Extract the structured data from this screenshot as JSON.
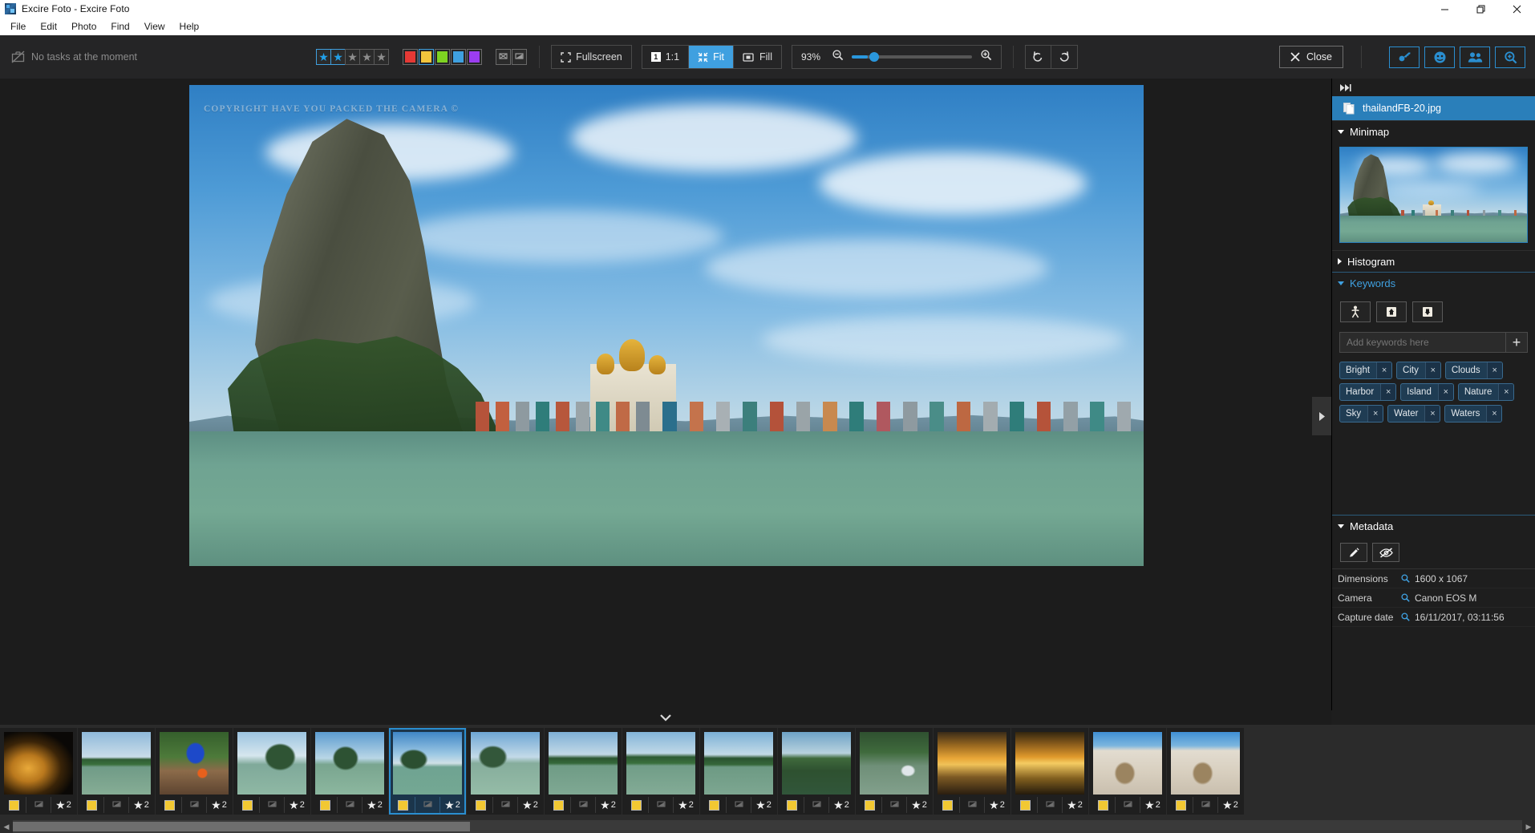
{
  "window": {
    "title": "Excire Foto - Excire Foto",
    "app_icon": "app-logo-icon",
    "minimize": "minimize-icon",
    "restore": "restore-icon",
    "close": "close-icon"
  },
  "menubar": {
    "items": [
      "File",
      "Edit",
      "Photo",
      "Find",
      "View",
      "Help"
    ]
  },
  "toolbar": {
    "task_status": "No tasks at the moment",
    "task_icon": "briefcase-off-icon",
    "ratings": [
      {
        "name": "star-1",
        "filled": true
      },
      {
        "name": "star-2",
        "filled": true
      },
      {
        "name": "star-3",
        "filled": false
      },
      {
        "name": "star-4",
        "filled": false
      },
      {
        "name": "star-5",
        "filled": false
      }
    ],
    "colors": [
      {
        "name": "red",
        "hex": "#e53935",
        "selected": false
      },
      {
        "name": "yellow",
        "hex": "#f2c43c",
        "selected": true
      },
      {
        "name": "green",
        "hex": "#7ed321",
        "selected": false
      },
      {
        "name": "blue",
        "hex": "#3fa0e0",
        "selected": false
      },
      {
        "name": "purple",
        "hex": "#9b3df0",
        "selected": false
      }
    ],
    "flags": [
      {
        "name": "flag-rejected-icon"
      },
      {
        "name": "flag-picked-icon"
      }
    ],
    "fullscreen_label": "Fullscreen",
    "view_modes": [
      {
        "label": "1:1",
        "active": false,
        "icon": "one-to-one-icon"
      },
      {
        "label": "Fit",
        "active": true,
        "icon": "fit-icon"
      },
      {
        "label": "Fill",
        "active": false,
        "icon": "fill-icon"
      }
    ],
    "zoom_percent": "93%",
    "zoom_out_icon": "zoom-out-icon",
    "zoom_in_icon": "zoom-in-icon",
    "zoom_slider_value": 13,
    "rotate_left_icon": "rotate-left-icon",
    "rotate_right_icon": "rotate-right-icon",
    "close_label": "Close",
    "right_icons": [
      {
        "name": "key-icon"
      },
      {
        "name": "face-icon"
      },
      {
        "name": "people-icon"
      },
      {
        "name": "search-photo-icon"
      }
    ]
  },
  "viewer": {
    "watermark": "COPYRIGHT HAVE YOU PACKED THE CAMERA ©",
    "collapse_handle_icon": "chevron-right-icon",
    "strip_toggle_icon": "chevron-down-icon"
  },
  "right_panel": {
    "fastforward_icon": "fast-forward-icon",
    "file_name": "thailandFB-20.jpg",
    "file_icon": "document-copy-icon",
    "sections": {
      "minimap": {
        "label": "Minimap",
        "expanded": true
      },
      "histogram": {
        "label": "Histogram",
        "expanded": false
      },
      "keywords": {
        "label": "Keywords",
        "expanded": true
      },
      "metadata": {
        "label": "Metadata",
        "expanded": true
      }
    },
    "keyword_tools": [
      {
        "name": "person-keyword-icon"
      },
      {
        "name": "import-keywords-icon"
      },
      {
        "name": "export-keywords-icon"
      }
    ],
    "keyword_input_placeholder": "Add keywords here",
    "keyword_add_label": "+",
    "keywords": [
      "Bright",
      "City",
      "Clouds",
      "Harbor",
      "Island",
      "Nature",
      "Sky",
      "Water",
      "Waters"
    ],
    "keyword_remove_label": "×",
    "metadata_tools": [
      {
        "name": "edit-metadata-icon"
      },
      {
        "name": "hide-metadata-icon"
      }
    ],
    "metadata": [
      {
        "key": "Dimensions",
        "value": "1600 x 1067"
      },
      {
        "key": "Camera",
        "value": "Canon EOS M"
      },
      {
        "key": "Capture date",
        "value": "16/11/2017, 03:11:56"
      }
    ]
  },
  "filmstrip": {
    "rating_value": "2",
    "color_label_hex": "#f2c832",
    "scroll_left_icon": "chevron-left-icon",
    "scroll_right_icon": "chevron-right-icon",
    "thumbs": [
      {
        "name": "thumb-buddha",
        "selected": false,
        "rating": "2",
        "color": "#f2c832"
      },
      {
        "name": "thumb-mangrove-1",
        "selected": false,
        "rating": "2",
        "color": "#f2c832"
      },
      {
        "name": "thumb-market-boat",
        "selected": false,
        "rating": "2",
        "color": "#f2c832"
      },
      {
        "name": "thumb-bay-boat",
        "selected": false,
        "rating": "2",
        "color": "#f2c832"
      },
      {
        "name": "thumb-james-bond-island",
        "selected": false,
        "rating": "2",
        "color": "#f2c832"
      },
      {
        "name": "thumb-thailandFB-20",
        "selected": true,
        "rating": "2",
        "color": "#f2c832"
      },
      {
        "name": "thumb-karst-water",
        "selected": false,
        "rating": "2",
        "color": "#f2c832"
      },
      {
        "name": "thumb-mangrove-2",
        "selected": false,
        "rating": "2",
        "color": "#f2c832"
      },
      {
        "name": "thumb-mangrove-3",
        "selected": false,
        "rating": "2",
        "color": "#f2c832"
      },
      {
        "name": "thumb-mangrove-4",
        "selected": false,
        "rating": "2",
        "color": "#f2c832"
      },
      {
        "name": "thumb-mangrove-5",
        "selected": false,
        "rating": "2",
        "color": "#f2c832"
      },
      {
        "name": "thumb-river-boat",
        "selected": false,
        "rating": "2",
        "color": "#f2c832"
      },
      {
        "name": "thumb-sunset-1",
        "selected": false,
        "rating": "2",
        "color": "#f2c832"
      },
      {
        "name": "thumb-sunset-2",
        "selected": false,
        "rating": "2",
        "color": "#f2c832"
      },
      {
        "name": "thumb-beach-rock-1",
        "selected": false,
        "rating": "2",
        "color": "#f2c832"
      },
      {
        "name": "thumb-beach-rock-2",
        "selected": false,
        "rating": "2",
        "color": "#f2c832"
      }
    ]
  }
}
